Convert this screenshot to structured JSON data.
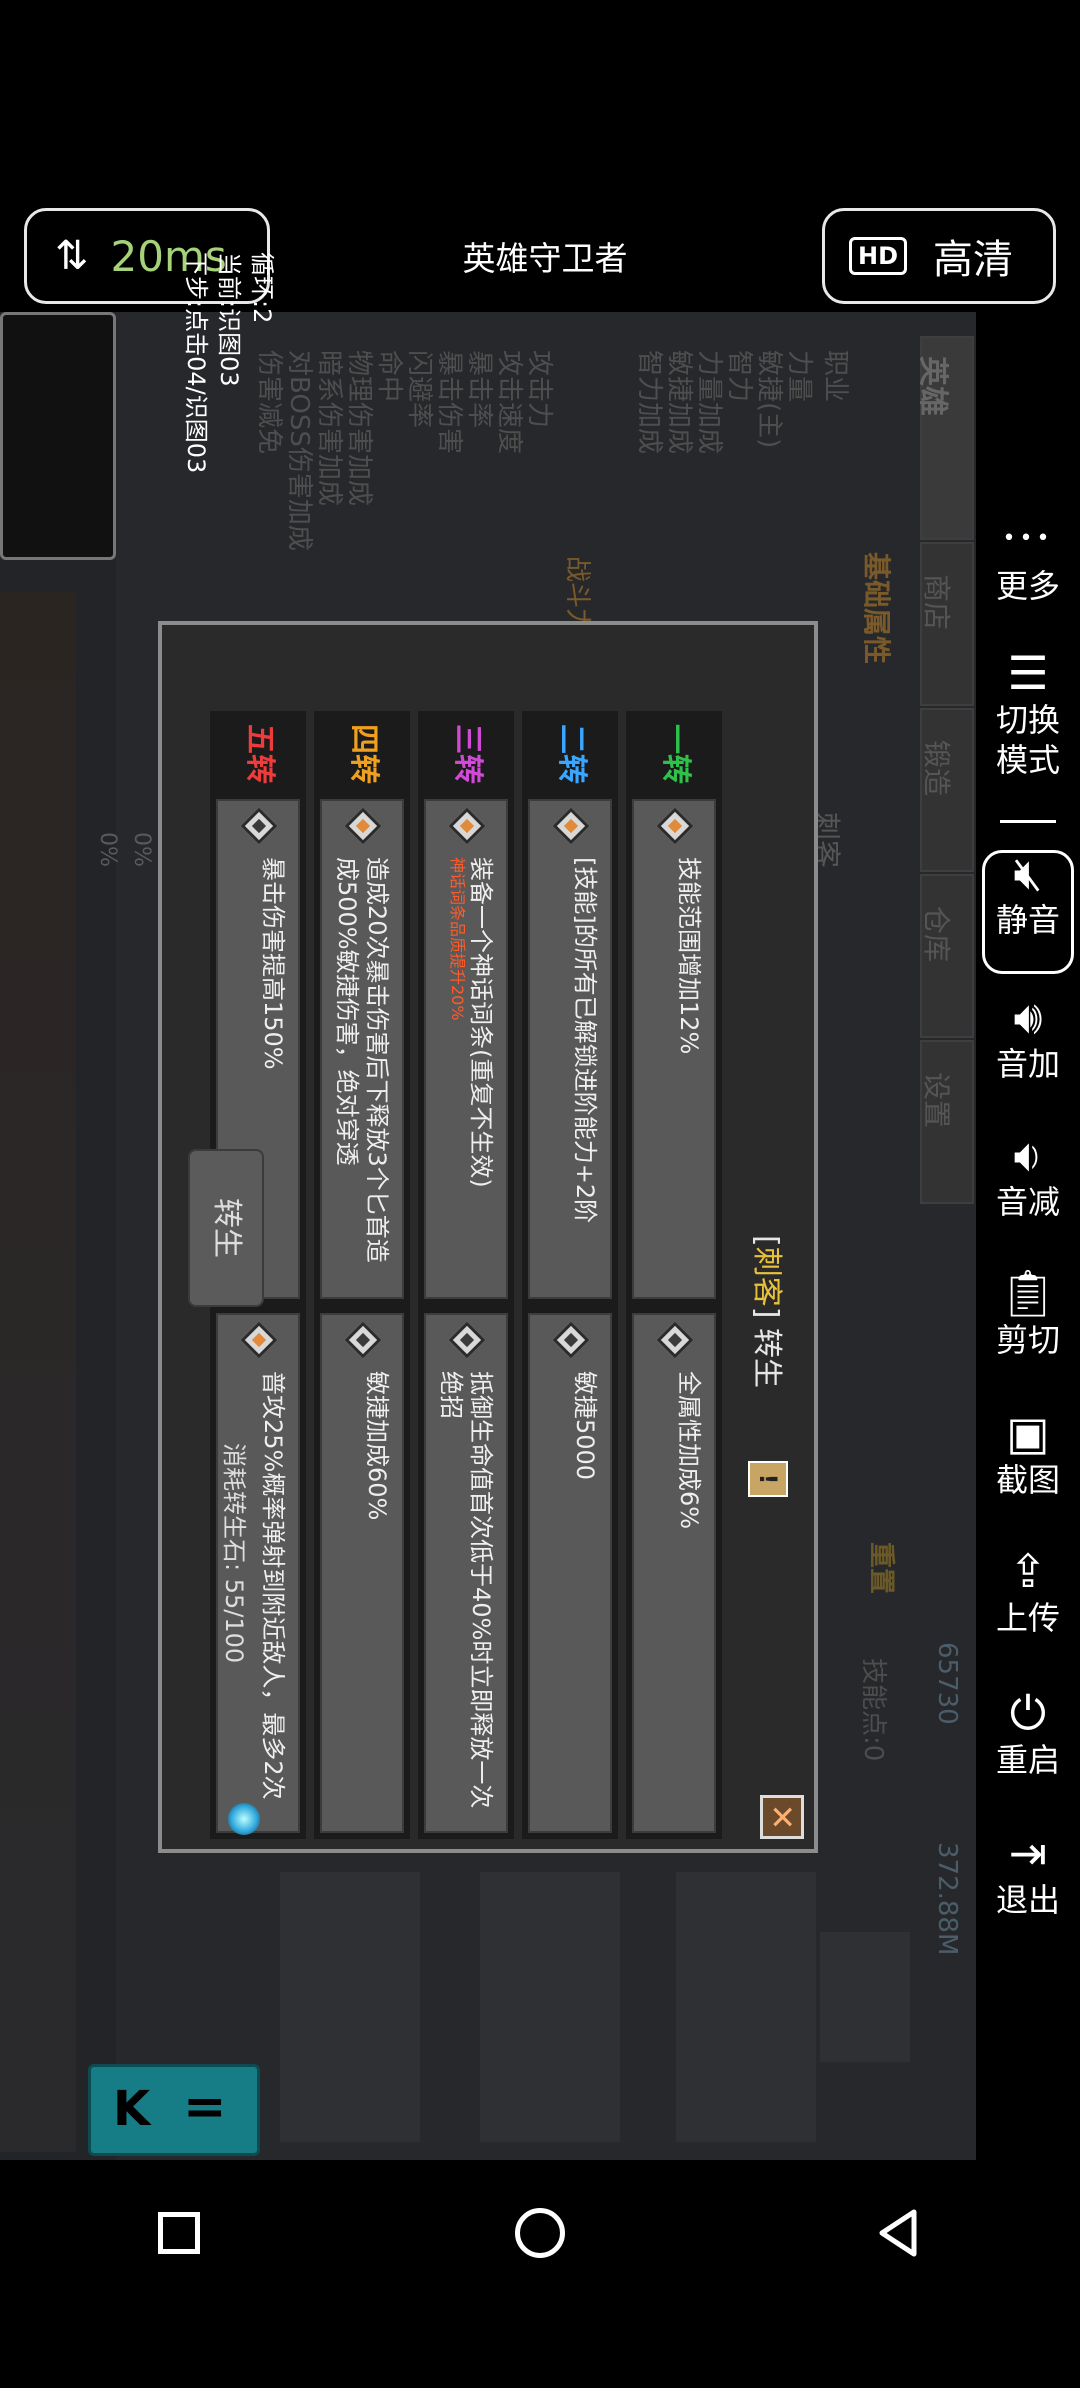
{
  "statusbar": {
    "ping": "20ms",
    "title": "英雄守卫者",
    "quality_badge": "HD",
    "quality": "高清"
  },
  "sidebar": {
    "items": [
      {
        "label": "更多",
        "icon": "more-icon"
      },
      {
        "label": "切换\n模式",
        "icon": "menu-icon"
      },
      {
        "label": "静音",
        "icon": "mute-icon"
      },
      {
        "label": "音加",
        "icon": "volume-up-icon"
      },
      {
        "label": "音减",
        "icon": "volume-down-icon"
      },
      {
        "label": "剪切",
        "icon": "clipboard-icon"
      },
      {
        "label": "截图",
        "icon": "screenshot-icon"
      },
      {
        "label": "上传",
        "icon": "upload-icon"
      },
      {
        "label": "重启",
        "icon": "power-icon"
      },
      {
        "label": "退出",
        "icon": "exit-icon"
      }
    ]
  },
  "script_overlay": {
    "line1": "循环:2",
    "line2": "当前:识图03",
    "line3": "下步:点击04/识图03"
  },
  "game_bg": {
    "tabs": [
      "英雄",
      "商店",
      "锻造",
      "仓库",
      "设置"
    ],
    "section": "基础属性",
    "class": "刺客",
    "stats": [
      "职业",
      "力量",
      "敏捷(主)",
      "智力",
      "力量加成",
      "敏捷加成",
      "智力加成",
      "攻击力",
      "攻击速度",
      "暴击率",
      "暴击伤害",
      "闪避率",
      "命中",
      "物理伤害加成",
      "暗系伤害加成",
      "对BOSS伤害加成",
      "伤害减免"
    ],
    "battle_power": "战斗力",
    "gems": "65730",
    "gold": "372.88M",
    "rebirth_btn": "重置",
    "skill_points": "技能点:0",
    "pcts": [
      "0%",
      "0%"
    ]
  },
  "dialog": {
    "title_prefix": "[",
    "title_class": "刺客",
    "title_suffix": "] 转生",
    "rows": [
      {
        "label": "一转",
        "color": "#2ec24a",
        "left": {
          "text": "技能范围增加12%",
          "active": true
        },
        "right": {
          "text": "全属性加成6%",
          "active": false
        }
      },
      {
        "label": "二转",
        "color": "#3aa6ff",
        "left": {
          "text": "[技能]的所有已解锁进阶能力+2阶",
          "active": true
        },
        "right": {
          "text": "敏捷5000",
          "active": false
        }
      },
      {
        "label": "三转",
        "color": "#d04ad6",
        "left": {
          "text": "装备一个神话词条(重复不生效)",
          "sub": "神话词条品质提升20%",
          "active": true
        },
        "right": {
          "text": "抵御生命值首次低于40%时立即释放一次绝招",
          "active": false
        }
      },
      {
        "label": "四转",
        "color": "#f0a020",
        "left": {
          "text": "造成20次暴击伤害后下释放3个匕首造成500%敏捷伤害，绝对穿透",
          "active": true
        },
        "right": {
          "text": "敏捷加成60%",
          "active": false
        }
      },
      {
        "label": "五转",
        "color": "#ee3b3b",
        "left": {
          "text": "暴击伤害提高150%",
          "active": false
        },
        "right": {
          "text": "普攻25%概率弹射到附近敌人，最多2次",
          "active": true
        }
      }
    ],
    "button": "转生",
    "cost_text": "消耗转生石: 55/100"
  },
  "hud": {
    "left_label": "K",
    "right_label": "="
  }
}
